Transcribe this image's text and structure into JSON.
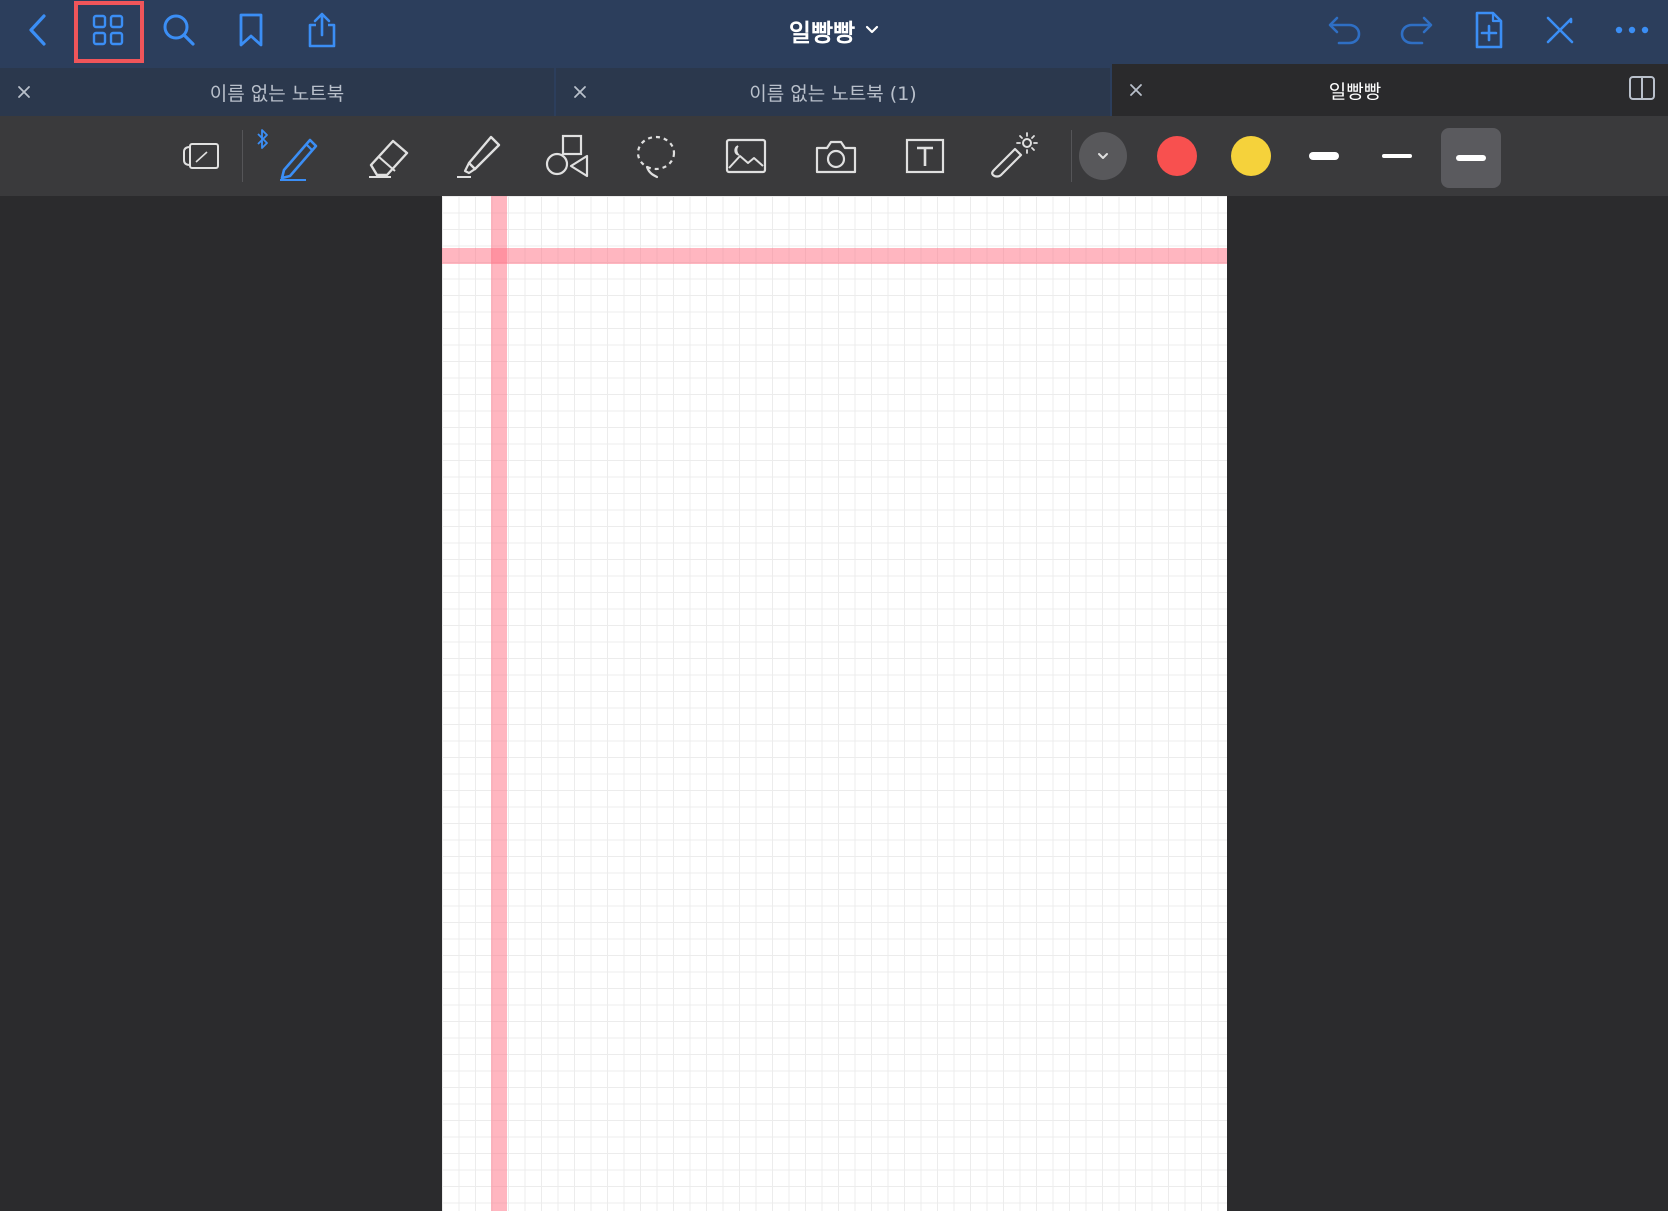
{
  "header": {
    "title": "일빵빵",
    "buttons": {
      "back": "back-icon",
      "thumbnails": "grid-icon",
      "search": "search-icon",
      "bookmark": "bookmark-icon",
      "share": "share-icon",
      "undo": "undo-icon",
      "redo": "redo-icon",
      "add_page": "add-page-icon",
      "close_pen": "pen-off-icon",
      "more": "more-icon"
    }
  },
  "tabs": [
    {
      "label": "이름 없는 노트북",
      "active": false
    },
    {
      "label": "이름 없는 노트북 (1)",
      "active": false
    },
    {
      "label": "일빵빵",
      "active": true
    }
  ],
  "tools": [
    "read-only-icon",
    "pen-icon",
    "eraser-icon",
    "highlighter-icon",
    "shapes-icon",
    "lasso-icon",
    "image-icon",
    "camera-icon",
    "text-icon",
    "laser-pointer-icon"
  ],
  "colors": {
    "accent": "#3b8ef5",
    "highlight": "#f0555a",
    "swatch_red": "#f8504f",
    "swatch_yellow": "#f5d23b",
    "page_margin": "#ff8fa0"
  },
  "strokes": [
    "thick",
    "thin",
    "medium"
  ]
}
